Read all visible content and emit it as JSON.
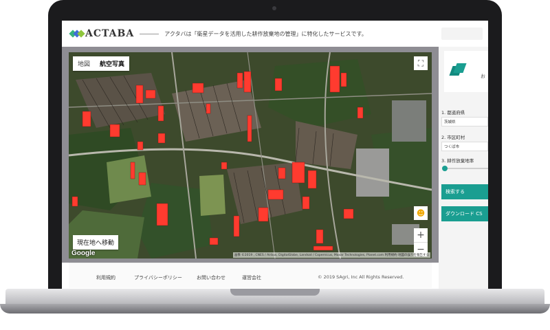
{
  "header": {
    "logo_text": "ACTABA",
    "tagline": "アクタバは「衛星データを活用した耕作放棄地の管理」に特化したサービスです。"
  },
  "map": {
    "tabs": [
      {
        "label": "地図",
        "active": false
      },
      {
        "label": "航空写真",
        "active": true
      }
    ],
    "fullscreen_icon": "fullscreen-icon",
    "pegman_icon": "pegman-icon",
    "zoom_in": "+",
    "zoom_out": "−",
    "locate_button": "現在地へ移動",
    "google_logo": "Google",
    "attribution": "画像 ©2019 , CNES / Airbus, DigitalGlobe, Landsat / Copernicus, Maxar Technologies, Planet.com   利用規約   地図の誤りを報告する",
    "highlight_color": "#ff3b2f"
  },
  "sidebar": {
    "fragment_text": "お",
    "prefecture_label": "1. 都道府県",
    "prefecture_value": "茨城県",
    "city_label": "2. 市区町村",
    "city_value": "つくば市",
    "rate_label": "3. 耕作放棄地率",
    "search_button": "検索する",
    "download_button": "ダウンロード CS",
    "accent_color": "#1a9e91"
  },
  "footer": {
    "links": [
      "利用規約",
      "プライバシーポリシー",
      "お問い合わせ",
      "運営会社"
    ],
    "copyright": "© 2019 SAgri, Inc All Rights Reserved."
  }
}
